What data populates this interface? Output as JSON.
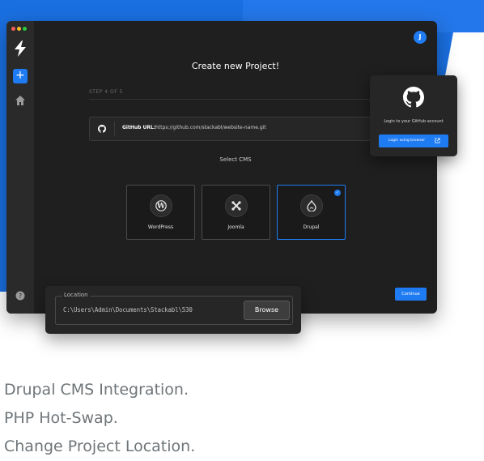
{
  "title": "Create new Project!",
  "step": "STEP 4 OF 5",
  "github": {
    "label": "GitHub URL:",
    "url": "https://github.com/stackabl/website-name.git",
    "icon": "github-icon"
  },
  "select_cms": "Select CMS",
  "cms_options": [
    {
      "label": "WordPress",
      "icon": "wordpress-icon",
      "selected": false
    },
    {
      "label": "Joomla",
      "icon": "joomla-icon",
      "selected": false
    },
    {
      "label": "Drupal",
      "icon": "drupal-icon",
      "selected": true
    }
  ],
  "continue_label": "Continue",
  "avatar_initial": "J",
  "sidebar": {
    "add_label": "+",
    "icons": [
      "bolt-logo-icon",
      "plus-icon",
      "home-icon",
      "help-icon"
    ]
  },
  "github_popup": {
    "text": "Login to your GitHub account",
    "button": "Login using browser"
  },
  "location": {
    "label": "Location",
    "path": "C:\\Users\\Admin\\Documents\\Stackabl\\530",
    "browse": "Browse"
  },
  "features": [
    "Drupal CMS Integration.",
    "PHP Hot-Swap.",
    "Change Project Location."
  ],
  "colors": {
    "accent": "#1f7bf2",
    "window_bg": "#1f1f1f",
    "background_blue": "#1a6fe0"
  }
}
